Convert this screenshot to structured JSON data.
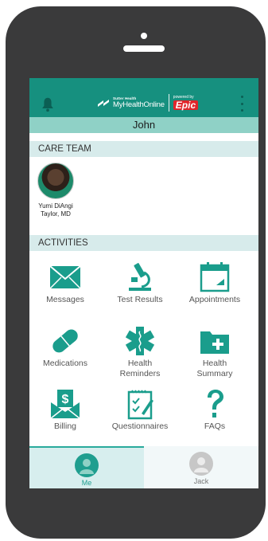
{
  "header": {
    "brand_top": "Sutter Health",
    "brand_main": "MyHealthOnline",
    "powered_by": "powered by",
    "epic": "Epic"
  },
  "user_name": "John",
  "care_team": {
    "title": "CARE TEAM",
    "members": [
      {
        "name_line1": "Yumi DiAngi",
        "name_line2": "Taylor, MD"
      }
    ]
  },
  "activities": {
    "title": "ACTIVITIES",
    "items": [
      {
        "label": "Messages",
        "icon": "envelope-icon"
      },
      {
        "label": "Test Results",
        "icon": "microscope-icon"
      },
      {
        "label": "Appointments",
        "icon": "calendar-icon"
      },
      {
        "label": "Medications",
        "icon": "pill-icon"
      },
      {
        "label_line1": "Health",
        "label_line2": "Reminders",
        "icon": "medical-star-icon"
      },
      {
        "label_line1": "Health",
        "label_line2": "Summary",
        "icon": "folder-plus-icon"
      },
      {
        "label": "Billing",
        "icon": "bill-envelope-icon"
      },
      {
        "label": "Questionnaires",
        "icon": "clipboard-icon"
      },
      {
        "label": "FAQs",
        "icon": "question-mark-icon"
      }
    ]
  },
  "tabs": [
    {
      "label": "Me",
      "active": true
    },
    {
      "label": "Jack",
      "active": false
    }
  ],
  "colors": {
    "teal": "#16907f",
    "accent": "#2aaa9c",
    "name_bar": "#8fd1c6",
    "section": "#d7ebeb",
    "epic_red": "#e0262b"
  }
}
